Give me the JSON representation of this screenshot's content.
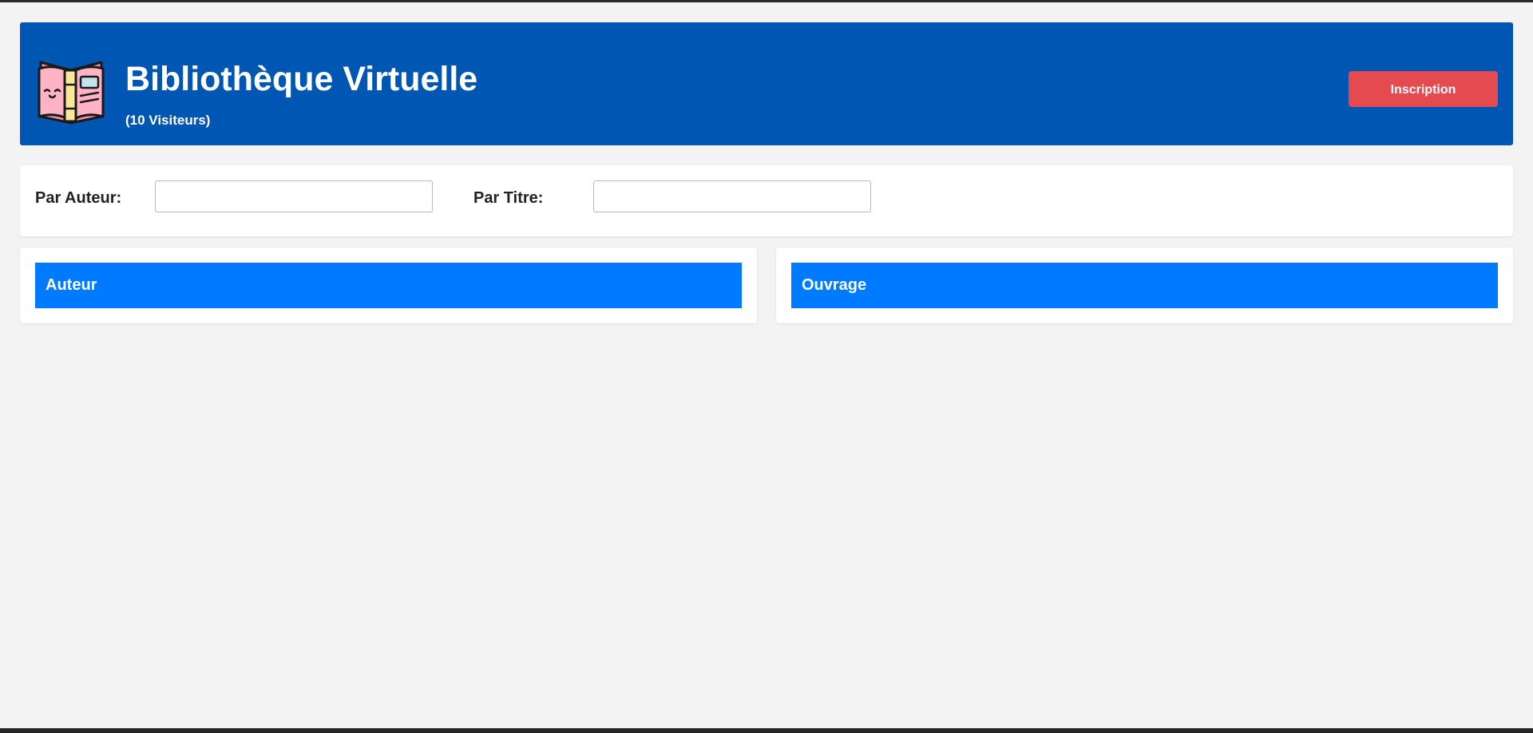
{
  "header": {
    "title": "Bibliothèque Virtuelle",
    "visitors": "(10 Visiteurs)",
    "signup_label": "Inscription",
    "logo_icon": "open-book-icon",
    "background_color": "#0056b3",
    "signup_color": "#e44a4f"
  },
  "search": {
    "author_label": "Par Auteur:",
    "author_value": "",
    "title_label": "Par Titre:",
    "title_value": ""
  },
  "panels": {
    "author_header": "Auteur",
    "book_header": "Ouvrage",
    "header_color": "#007bff"
  }
}
